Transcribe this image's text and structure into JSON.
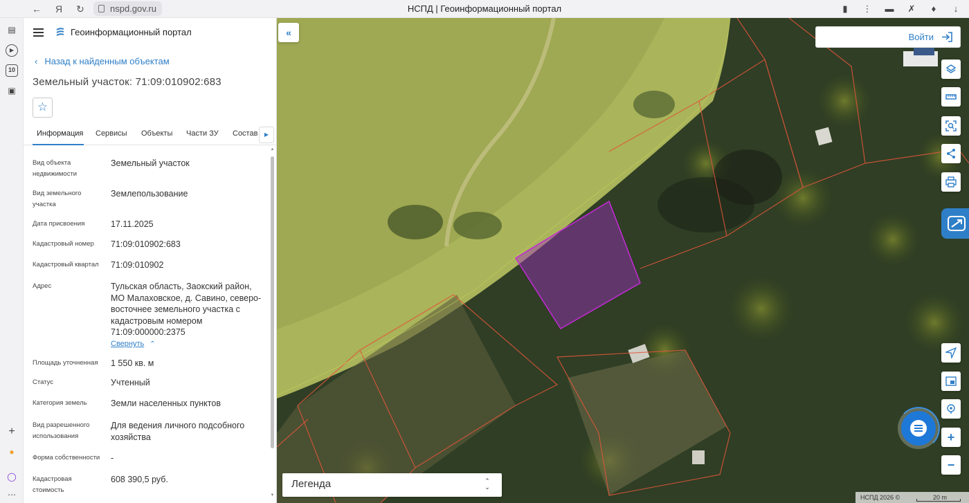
{
  "browser": {
    "url": "nspd.gov.ru",
    "tab_title": "НСПД | Геоинформационный портал",
    "notification_count": "10"
  },
  "header": {
    "portal_title": "Геоинформационный портал"
  },
  "nav": {
    "back_label": "Назад к найденным объектам"
  },
  "object": {
    "title": "Земельный участок: 71:09:010902:683"
  },
  "tabs": [
    {
      "label": "Информация",
      "active": true
    },
    {
      "label": "Сервисы"
    },
    {
      "label": "Объекты"
    },
    {
      "label": "Части ЗУ"
    },
    {
      "label": "Состав"
    }
  ],
  "properties": [
    {
      "label": "Вид объекта недвижимости",
      "value": "Земельный участок"
    },
    {
      "label": "Вид земельного участка",
      "value": "Землепользование"
    },
    {
      "label": "Дата присвоения",
      "value": "17.11.2025"
    },
    {
      "label": "Кадастровый номер",
      "value": "71:09:010902:683"
    },
    {
      "label": "Кадастровый квартал",
      "value": "71:09:010902"
    },
    {
      "label": "Адрес",
      "value": "Тульская область, Заокский район, МО Малаховское, д. Савино, северо-восточнее земельного участка с кадастровым номером 71:09:000000:2375"
    },
    {
      "label": "Площадь уточненная",
      "value": "1 550 кв. м"
    },
    {
      "label": "Статус",
      "value": "Учтенный"
    },
    {
      "label": "Категория земель",
      "value": "Земли населенных пунктов"
    },
    {
      "label": "Вид разрешенного использования",
      "value": "Для ведения личного подсобного хозяйства"
    },
    {
      "label": "Форма собственности",
      "value": "-"
    },
    {
      "label": "Кадастровая стоимость",
      "value": "608 390,5 руб."
    }
  ],
  "address_collapse_label": "Свернуть",
  "map": {
    "login_label": "Войти",
    "legend_label": "Легенда",
    "attribution": "НСПД 2026 ©",
    "scale_label": "20 m",
    "highlight_color": "#c42ad6",
    "boundary_color": "#e0563a"
  },
  "icons": {
    "menu": "hamburger-icon",
    "back": "chevron-left-icon",
    "favorite": "star-icon",
    "tabs_next": "chevron-right-icon",
    "collapse_panel": "double-chevron-left-icon",
    "login": "login-icon",
    "layers": "layers-icon",
    "measure": "ruler-icon",
    "select_area": "search-area-icon",
    "share": "share-icon",
    "print": "print-icon",
    "locate": "navigation-arrow-icon",
    "minimap": "minimap-icon",
    "geo": "geolocation-icon",
    "zoom_in": "plus-icon",
    "zoom_out": "minus-icon",
    "chat": "chat-icon",
    "legend_toggle": "up-down-icon"
  }
}
